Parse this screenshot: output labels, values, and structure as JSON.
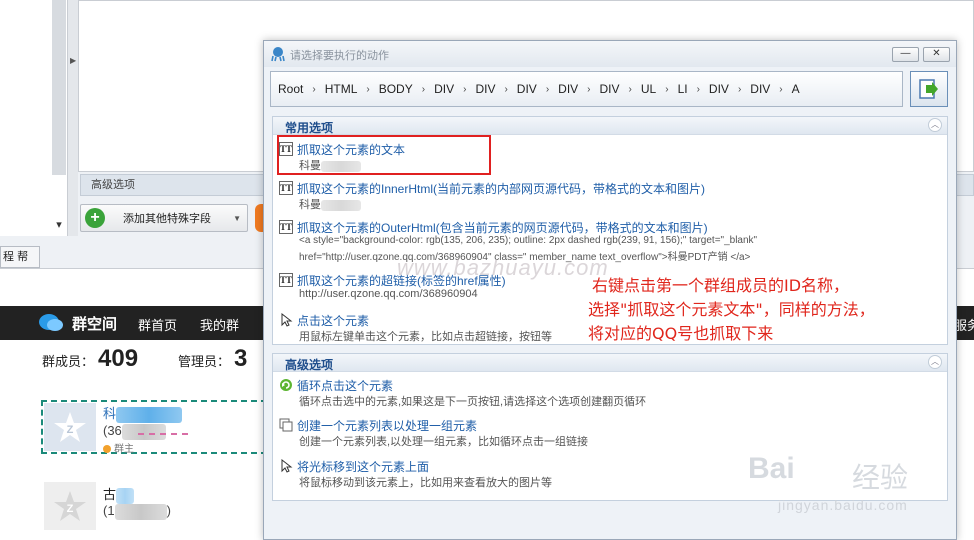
{
  "background_app": {
    "advanced_options_label": "高级选项",
    "add_field_button": "添加其他特殊字段",
    "help_tab": "帮助",
    "help_tab_prefix": "程",
    "scroll_down_glyph": "▾"
  },
  "qq_page": {
    "brand": "群空间",
    "nav": [
      "群首页",
      "我的群",
      "服务"
    ],
    "member_count_label": "群成员：",
    "member_count": "409",
    "admin_count_label": "管理员：",
    "admin_count": "3",
    "members": [
      {
        "name_visible": "科",
        "qq_visible": "(36",
        "role": "群主"
      },
      {
        "name_visible": "古",
        "qq_visible": "(1",
        "qq_suffix": ")"
      }
    ]
  },
  "dialog": {
    "title": "请选择要执行的动作",
    "min_label": "—",
    "close_label": "✕",
    "path": [
      "Root",
      "HTML",
      "BODY",
      "DIV",
      "DIV",
      "DIV",
      "DIV",
      "DIV",
      "UL",
      "LI",
      "DIV",
      "DIV",
      "A"
    ],
    "path_separator": "›",
    "common_section": "常用选项",
    "advanced_section": "高级选项",
    "common_options": [
      {
        "icon": "text-tt-icon",
        "title": "抓取这个元素的文本",
        "desc": "科曼"
      },
      {
        "icon": "text-tt-icon",
        "title": "抓取这个元素的InnerHtml(当前元素的内部网页源代码，带格式的文本和图片)",
        "desc": "科曼"
      },
      {
        "icon": "text-tt-icon",
        "title": "抓取这个元素的OuterHtml(包含当前元素的网页源代码，带格式的文本和图片)",
        "desc": "<a style=\"background-color: rgb(135, 206, 235); outline: 2px dashed rgb(239, 91, 156);\" target=\"_blank\"",
        "desc2": "href=\"http://user.qzone.qq.com/368960904\" class=\" member_name text_overflow\">科曼PDT产销 </a>"
      },
      {
        "icon": "text-tt-icon",
        "title": "抓取这个元素的超链接(标签的href属性)",
        "desc": "http://user.qzone.qq.com/368960904"
      },
      {
        "icon": "cursor-icon",
        "title": "点击这个元素",
        "desc": "用鼠标左键单击这个元素，比如点击超链接，按钮等"
      }
    ],
    "advanced_options": [
      {
        "icon": "loop-icon",
        "title": "循环点击这个元素",
        "desc": "循环点击选中的元素,如果这是下一页按钮,请选择这个选项创建翻页循环"
      },
      {
        "icon": "list-icon",
        "title": "创建一个元素列表以处理一组元素",
        "desc": "创建一个元素列表,以处理一组元素，比如循环点击一组链接"
      },
      {
        "icon": "cursor-icon",
        "title": "将光标移到这个元素上面",
        "desc": "将鼠标移动到该元素上，比如用来查看放大的图片等"
      }
    ],
    "collapse_glyph": "︿"
  },
  "annotation": {
    "line1": "右键点击第一个群组成员的ID名称，",
    "line2": "选择\"抓取这个元素文本\"，同样的方法，",
    "line3": "将对应的QQ号也抓取下来"
  },
  "watermark": {
    "text": "www.bazhuayu.com",
    "baidu_brand": "Bai",
    "baidu_jingyan": "经验",
    "baidu_url": "jingyan.baidu.com"
  },
  "colors": {
    "annotation_red": "#e0261c",
    "link_blue": "#1f5ea8",
    "nav_dark": "#222222",
    "highlight_teal": "#1b8a7a"
  }
}
